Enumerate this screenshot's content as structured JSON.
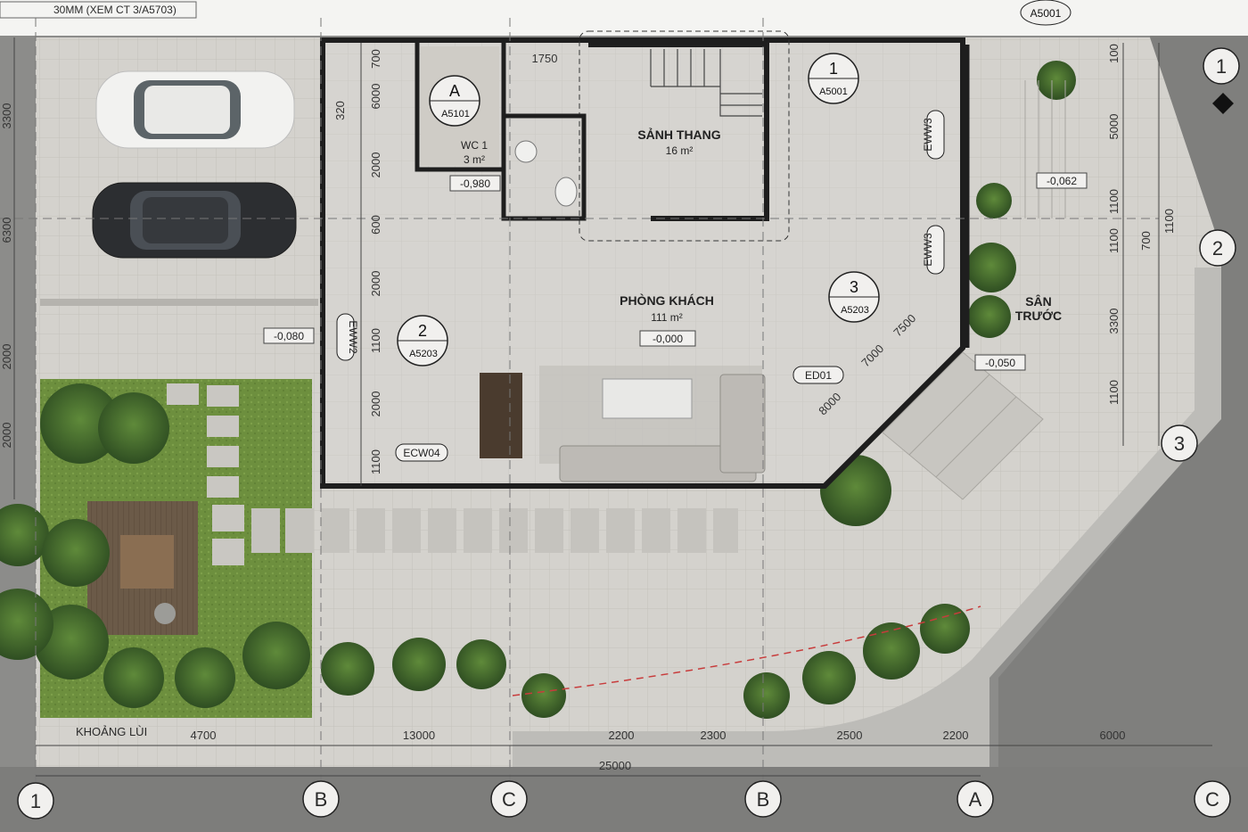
{
  "note_top": "30MM (XEM CT 3/A5703)",
  "rooms": {
    "living": {
      "name": "PHÒNG KHÁCH",
      "area": "111 m²",
      "level": "-0,000"
    },
    "stair_hall": {
      "name": "SẢNH THANG",
      "area": "16 m²"
    },
    "wc": {
      "name": "WC 1",
      "area": "3 m²",
      "level": "-0,980"
    },
    "front_yard": {
      "name1": "SÂN",
      "name2": "TRƯỚC"
    }
  },
  "levels": {
    "carport": "-0,080",
    "yard": "-0,062",
    "entry": "-0,050"
  },
  "section_tags": {
    "a": {
      "id": "A",
      "sheet": "A5101"
    },
    "one": {
      "id": "1",
      "sheet": "A5001"
    },
    "two": {
      "id": "2",
      "sheet": "A5203"
    },
    "three": {
      "id": "3",
      "sheet": "A5203"
    },
    "top_right_sheet": "A5001"
  },
  "elements": {
    "ed01": "ED01",
    "ecw04": "ECW04",
    "eww2": "EWW2",
    "eww3_top": "EWW3",
    "eww3_mid": "EWW3"
  },
  "setback_label": "KHOẢNG LÙI",
  "dims_bottom": [
    "4700",
    "13000",
    "2200",
    "2300",
    "2500",
    "2200",
    "6000"
  ],
  "dim_total": "25000",
  "dims_left": [
    "3300",
    "6300",
    "2000",
    "2000"
  ],
  "dims_inner_left": [
    "700",
    "6000",
    "2000",
    "600",
    "2000",
    "1100",
    "2000",
    "1100"
  ],
  "dim_320": "320",
  "dim_1750": "1750",
  "dims_right": [
    "100",
    "5000",
    "1100",
    "1100",
    "3300",
    "1100"
  ],
  "dims_right_2": [
    "700",
    "1100"
  ],
  "dims_diag": [
    "7500",
    "7000",
    "8000"
  ],
  "axes_bottom": [
    "1",
    "B",
    "C",
    "B",
    "A",
    "C"
  ],
  "axes_right": [
    "1",
    "2",
    "3"
  ]
}
